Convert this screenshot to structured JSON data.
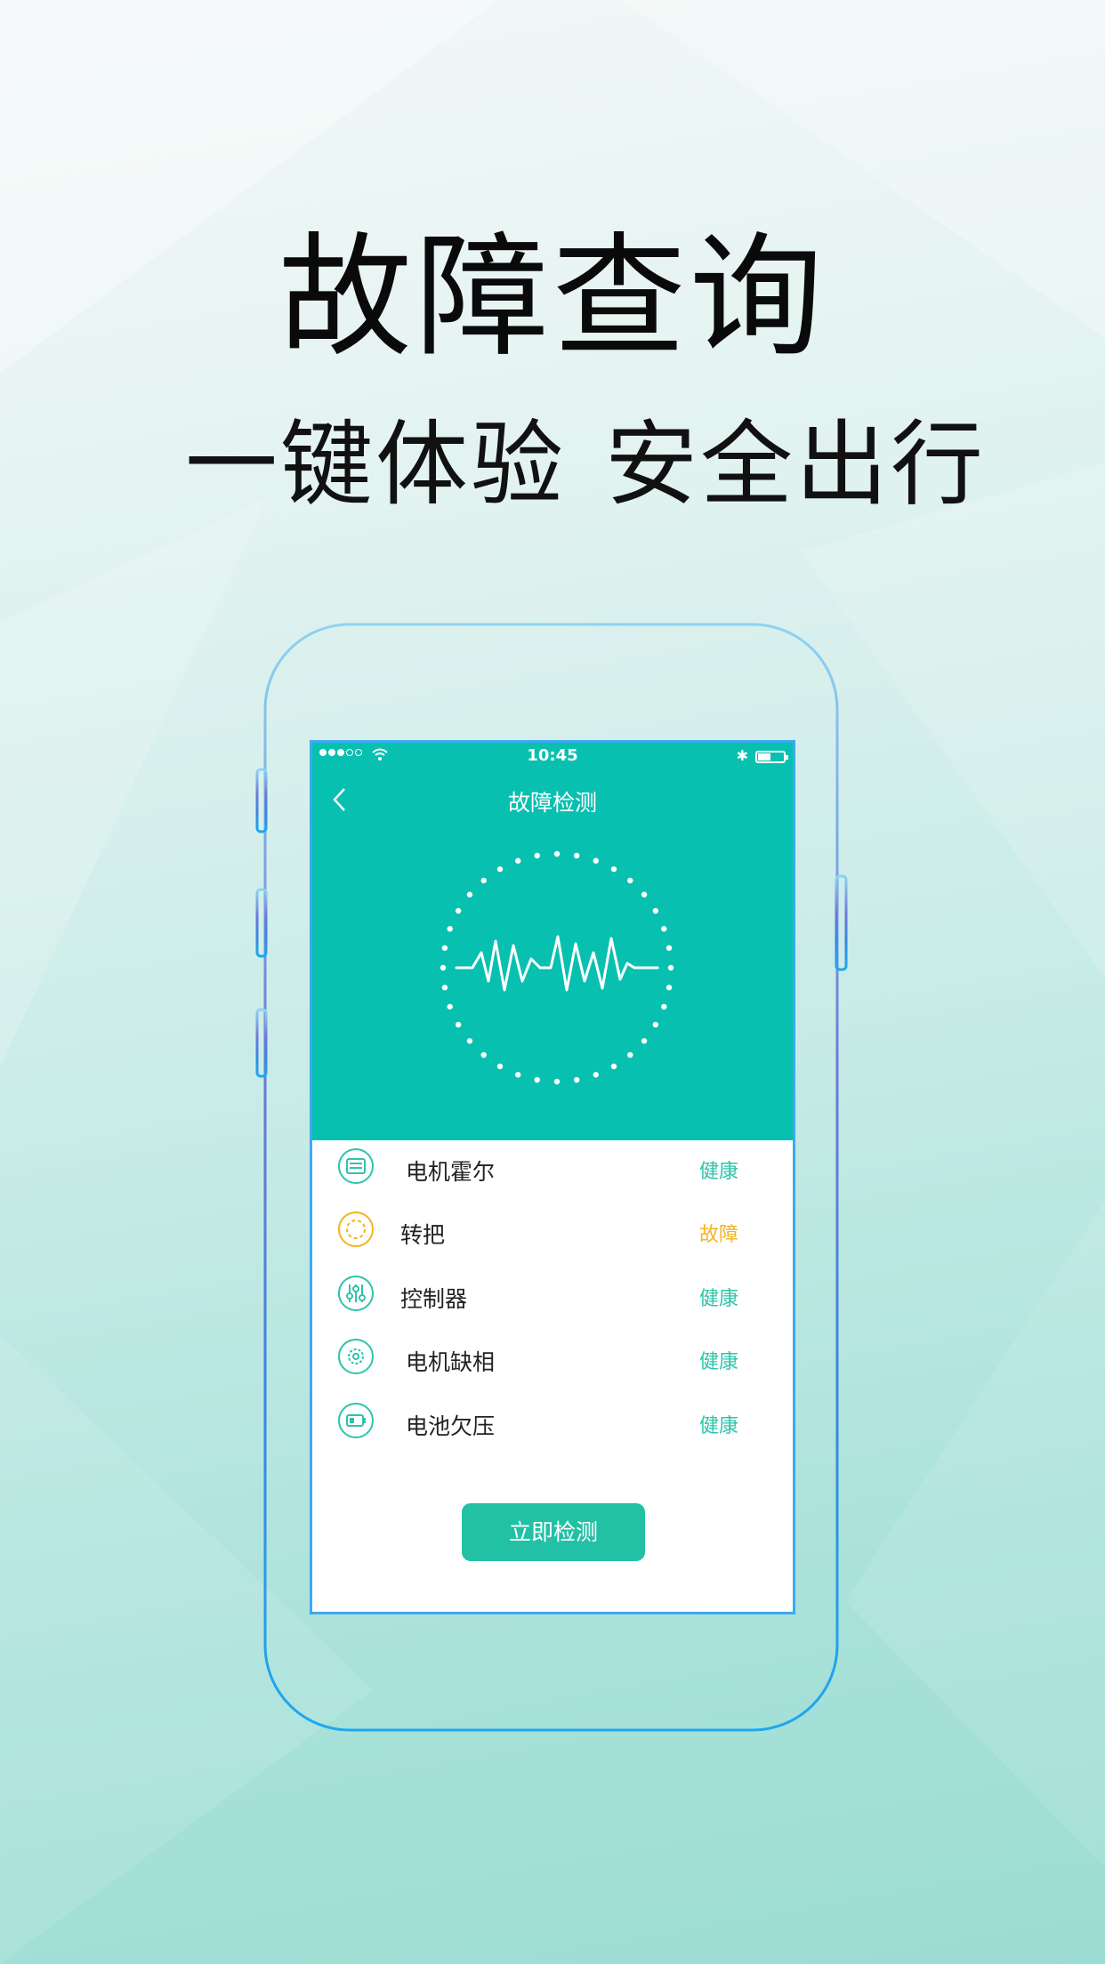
{
  "headline": "故障查询",
  "subline": {
    "left": "一键体验",
    "right": "安全出行"
  },
  "phone": {
    "status_bar": {
      "time": "10:45",
      "signal_filled": 3,
      "signal_total": 5,
      "battery_level": 0.45
    },
    "nav": {
      "title": "故障检测",
      "back_icon": "chevron-left-icon"
    },
    "checks": [
      {
        "label": "电机霍尔",
        "status": "健康",
        "icon": "motor-icon"
      },
      {
        "label": "转把",
        "status": "故障",
        "icon": "ring-icon"
      },
      {
        "label": "控制器",
        "status": "健康",
        "icon": "sliders-icon"
      },
      {
        "label": "电机缺相",
        "status": "健康",
        "icon": "gear-icon"
      },
      {
        "label": "电池欠压",
        "status": "健康",
        "icon": "battery-icon"
      }
    ],
    "detect_button": "立即检测"
  },
  "colors": {
    "accent": "#08c0b0",
    "healthy": "#2ec4ab",
    "fault": "#f5b41d",
    "button": "#22c1a5",
    "frame": "#3da9f0"
  }
}
